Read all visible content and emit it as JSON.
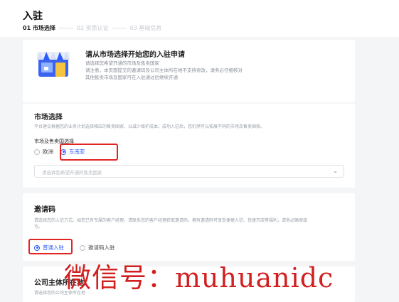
{
  "header": {
    "title": "入驻",
    "steps": [
      {
        "label": "01 市场选择",
        "active": true
      },
      {
        "label": "02 资质认证",
        "active": false
      },
      {
        "label": "03 基础信息",
        "active": false
      }
    ]
  },
  "banner": {
    "icon": "shop-storefront-icon",
    "title": "请从市场选择开始您的入驻申请",
    "lines": [
      "请选择您希望开通的市场及售卖国家",
      "请注意，本页面提交的邀请码及公司主体所在地不支持修改，请务必仔细核对",
      "其他售卖市场及国家可在入驻通过后继续开通"
    ]
  },
  "market": {
    "title": "市场选择",
    "desc": "平台建议根据您的业务计划选择相应的售卖国家，以减少维护成本。成功入驻后，您仍然可以拓展不同的市场及售卖国家。",
    "sub_label": "市场及售卖国选择",
    "options": [
      "欧洲",
      "东南亚"
    ],
    "selected": "东南亚",
    "select_placeholder": "请选择您希望开通的售卖国家"
  },
  "invite": {
    "title": "邀请码",
    "desc_line1": "请选择您的入驻方式。如您已有专属的客户经理，请联系您的客户经理获取邀请码。拥有邀请码可享受便捷入驻、快速开店等福利，请务必确保填",
    "desc_line2": "写。",
    "options": [
      "普通入驻",
      "邀请码入驻"
    ],
    "selected": "普通入驻"
  },
  "company": {
    "title": "公司主体所在地",
    "desc": "请选择您的公司主体所在地"
  },
  "overlay_text": "微信号：muhuanidc",
  "colors": {
    "accent": "#2e5bff",
    "highlight": "#e32424",
    "overlay": "#d21f1f"
  }
}
